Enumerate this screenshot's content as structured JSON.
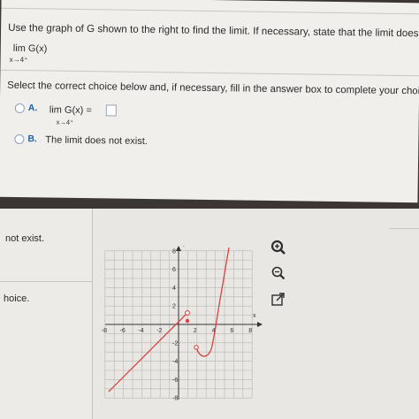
{
  "question": {
    "instruction": "Use the graph of G shown to the right to find the limit. If necessary, state that the limit does not exist.",
    "limit_text": "lim  G(x)",
    "limit_sub": "x→4⁺"
  },
  "prompt": "Select the correct choice below and, if necessary, fill in the answer box to complete your choice.",
  "choices": [
    {
      "letter": "A.",
      "text": "lim  G(x) =",
      "sub": "x→4⁺",
      "answer": ""
    },
    {
      "letter": "B.",
      "text": "The limit does not exist."
    }
  ],
  "left_fragments": {
    "not_exist": "not exist.",
    "choice": "hoice."
  },
  "graph": {
    "y_axis_label": "y",
    "x_axis_label": "x",
    "x_ticks": [
      "-8",
      "-6",
      "-4",
      "-2",
      "2",
      "4",
      "6",
      "8"
    ],
    "y_ticks": [
      "8",
      "6",
      "4",
      "2",
      "-2",
      "-4",
      "-6",
      "-8"
    ],
    "line_color": "#d9433f"
  },
  "tools": [
    {
      "name": "zoom-in-icon"
    },
    {
      "name": "zoom-out-icon"
    },
    {
      "name": "external-link-icon"
    }
  ]
}
